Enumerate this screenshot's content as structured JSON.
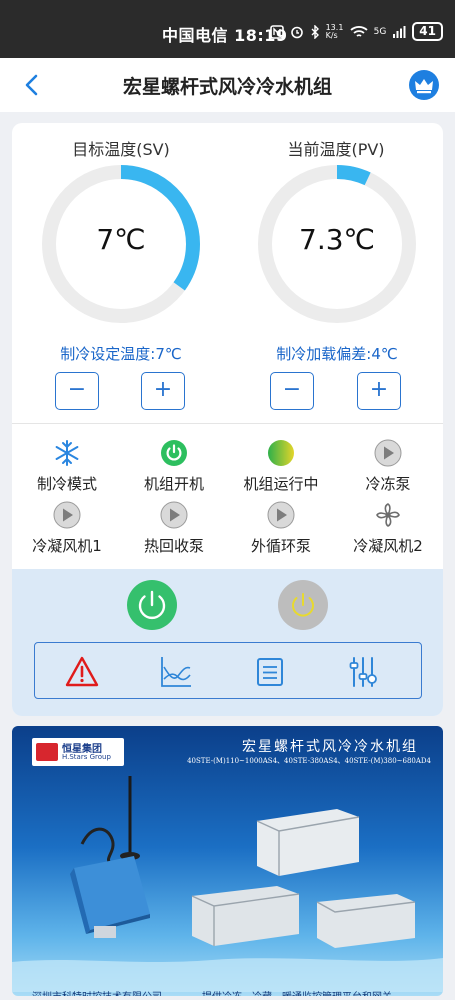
{
  "status_bar": {
    "carrier": "中国电信",
    "time": "18:19",
    "net_speed": "13.1 K/s",
    "signal": "5G",
    "battery": "41"
  },
  "nav": {
    "title": "宏星螺杆式风冷冷水机组"
  },
  "gauges": [
    {
      "title": "目标温度(SV)",
      "value": "7℃",
      "fill": 0.35,
      "setting": "制冷设定温度:7℃"
    },
    {
      "title": "当前温度(PV)",
      "value": "7.3℃",
      "fill": 0.07,
      "setting": "制冷加载偏差:4℃"
    }
  ],
  "stepper": {
    "minus": "−",
    "plus": "+"
  },
  "status_items": [
    {
      "label": "制冷模式",
      "icon": "snowflake-icon"
    },
    {
      "label": "机组开机",
      "icon": "power-on-icon"
    },
    {
      "label": "机组运行中",
      "icon": "running-indicator-icon"
    },
    {
      "label": "冷冻泵",
      "icon": "play-icon"
    },
    {
      "label": "冷凝风机1",
      "icon": "play-icon"
    },
    {
      "label": "热回收泵",
      "icon": "play-icon"
    },
    {
      "label": "外循环泵",
      "icon": "play-icon"
    },
    {
      "label": "冷凝风机2",
      "icon": "fan-icon"
    }
  ],
  "controls": {
    "power_on_color": "#35c06d",
    "power_off_color": "#bdbdbd",
    "tools": [
      "alarm-icon",
      "chart-icon",
      "list-icon",
      "settings-sliders-icon"
    ]
  },
  "banner": {
    "logo_cn": "恒星集团",
    "logo_en": "H.Stars Group",
    "title": "宏星螺杆式风冷冷水机组",
    "models": "40STE-(M)110~1000AS4、40STE-380AS4、40STE-(M)380~680AD4",
    "footer_left": "深圳市科特时控技术有限公司",
    "footer_right": "提供冷冻、冷藏、暖通监控管理平台和网关"
  },
  "colors": {
    "accent": "#1e7fe0",
    "gauge_fill": "#39b6f0",
    "gauge_track": "#ececec",
    "setting_text": "#1a66c9",
    "panel_bg": "#dbe9f7"
  }
}
